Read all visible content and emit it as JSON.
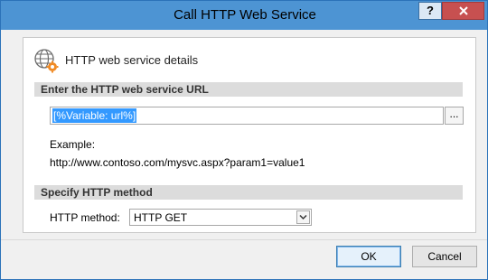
{
  "window": {
    "title": "Call HTTP Web Service",
    "help_label": "?",
    "close_label": "X"
  },
  "panel": {
    "title": "HTTP web service details",
    "icon": "globe-gear-icon"
  },
  "url_section": {
    "header": "Enter the HTTP web service URL",
    "value": "[%Variable: url%]",
    "browse_label": "...",
    "example_label": "Example:",
    "example_url": "http://www.contoso.com/mysvc.aspx?param1=value1"
  },
  "method_section": {
    "header": "Specify HTTP method",
    "label": "HTTP method:",
    "selected": "HTTP GET"
  },
  "buttons": {
    "ok": "OK",
    "cancel": "Cancel"
  },
  "colors": {
    "titlebar": "#4d94d3",
    "close": "#c75050",
    "selection": "#3399ff"
  }
}
